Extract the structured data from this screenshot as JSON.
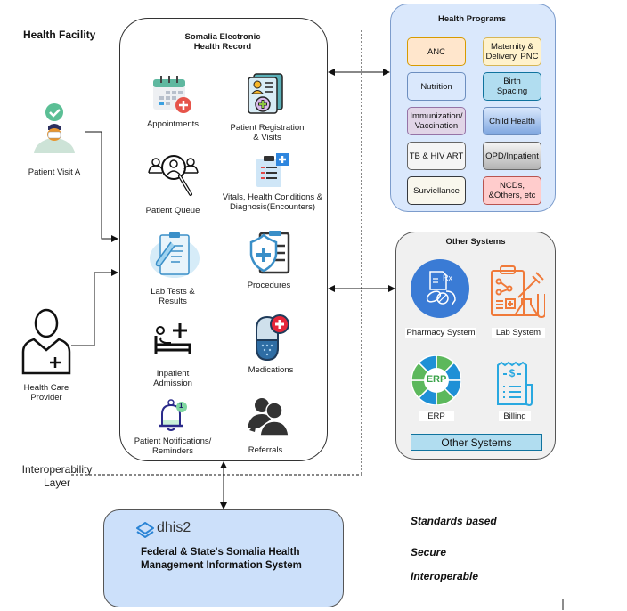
{
  "health_facility": {
    "title": "Health Facility"
  },
  "actors": {
    "patient": {
      "label": "Patient Visit A",
      "icon": "patient-masked-icon"
    },
    "provider": {
      "label_line1": "Health Care",
      "label_line2": "Provider",
      "icon": "health-care-provider-icon"
    }
  },
  "ehr": {
    "title_line1": "Somalia Electronic",
    "title_line2": "Health Record",
    "modules": [
      {
        "l1": "Appointments",
        "l2": "",
        "icon": "calendar-add-icon"
      },
      {
        "l1": "Patient Registration",
        "l2": "& Visits",
        "icon": "patient-record-icon"
      },
      {
        "l1": "Patient Queue",
        "l2": "",
        "icon": "people-search-icon"
      },
      {
        "l1": "Vitals, Health Conditions &",
        "l2": "Diagnosis(Encounters)",
        "icon": "clipboard-plus-icon"
      },
      {
        "l1": "Lab Tests &",
        "l2": "Results",
        "icon": "lab-clipboard-icon"
      },
      {
        "l1": "Procedures",
        "l2": "",
        "icon": "shield-clipboard-icon"
      },
      {
        "l1": "Inpatient",
        "l2": "Admission",
        "icon": "hospital-bed-icon"
      },
      {
        "l1": "Medications",
        "l2": "",
        "icon": "pill-icon"
      },
      {
        "l1": "Patient Notifications/",
        "l2": "Reminders",
        "icon": "bell-icon"
      },
      {
        "l1": "Referrals",
        "l2": "",
        "icon": "referral-people-icon"
      }
    ],
    "bell_badge": "1"
  },
  "health_programs": {
    "title": "Health Programs",
    "items": [
      {
        "l1": "ANC",
        "l2": ""
      },
      {
        "l1": "Maternity &",
        "l2": "Delivery, PNC"
      },
      {
        "l1": "Nutrition",
        "l2": ""
      },
      {
        "l1": "Birth",
        "l2": "Spacing"
      },
      {
        "l1": "Immunization/",
        "l2": "Vaccination"
      },
      {
        "l1": "Child Health",
        "l2": ""
      },
      {
        "l1": "TB & HIV ART",
        "l2": ""
      },
      {
        "l1": "OPD/Inpatient",
        "l2": ""
      },
      {
        "l1": "Surviellance",
        "l2": ""
      },
      {
        "l1": "NCDs,",
        "l2": "&Others, etc"
      }
    ]
  },
  "other_systems": {
    "title": "Other Systems",
    "items": [
      {
        "label": "Pharmacy System",
        "icon": "pharmacy-rx-icon"
      },
      {
        "label": "Lab System",
        "icon": "lab-system-icon"
      },
      {
        "label": "ERP",
        "icon": "erp-wheel-icon",
        "badge": "ERP"
      },
      {
        "label": "Billing",
        "icon": "billing-receipt-icon",
        "badge": "$"
      }
    ],
    "button_label": "Other Systems"
  },
  "interoperability": {
    "line1": "Interoperability",
    "line2": "Layer"
  },
  "dhis": {
    "logo_text": "dhis2",
    "line1": "Federal & State's Somalia  Health",
    "line2": "Management Information System"
  },
  "principles": [
    "Standards based",
    "Secure",
    "Interoperable"
  ],
  "colors": {
    "program_bg": "#dae8fc",
    "other_bg": "#f0f0f0",
    "dhis_bg": "#cce0fa",
    "pharmacy_blue": "#3a7bd5",
    "lab_orange": "#f07a3a",
    "billing_blue": "#29a8e0",
    "erp_green": "#5cb85c"
  }
}
